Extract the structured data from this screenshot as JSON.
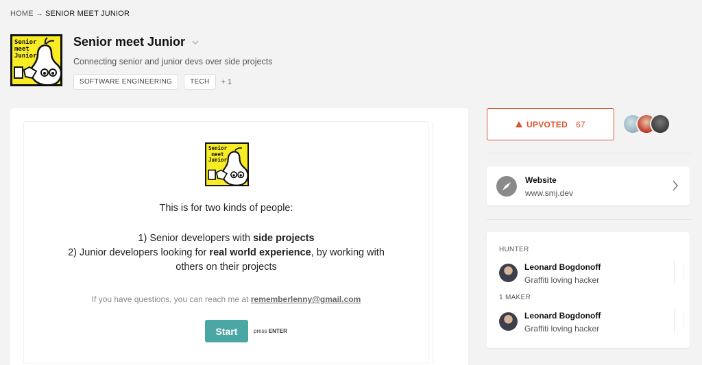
{
  "breadcrumb": {
    "home": "HOME",
    "separator": "→",
    "current": "SENIOR MEET JUNIOR"
  },
  "product": {
    "logo_text": "Senior\nmeet\nJunior",
    "title": "Senior meet Junior",
    "tagline": "Connecting senior and junior devs over side projects",
    "tags": [
      "SOFTWARE ENGINEERING",
      "TECH"
    ],
    "tags_more": "+ 1"
  },
  "embed": {
    "logo_text": "Senior\nmeet\nJunior",
    "intro": "This is for two kinds of people:",
    "point1_prefix": "1) Senior developers with ",
    "point1_bold": "side projects",
    "point2_prefix": "2) Junior developers looking for ",
    "point2_bold": "real world experience",
    "point2_suffix": ", by working with",
    "point2_line2": "others on their projects",
    "contact_prefix": "If you have questions, you can reach me at ",
    "contact_email": "rememberlenny@gmail.com",
    "start_label": "Start",
    "press_prefix": "press ",
    "press_key": "ENTER"
  },
  "upvote": {
    "label": "UPVOTED",
    "count": "67",
    "color": "#d9532c"
  },
  "website": {
    "label": "Website",
    "url": "www.smj.dev"
  },
  "people": {
    "hunter_label": "HUNTER",
    "hunter": {
      "name": "Leonard Bogdonoff",
      "desc": "Graffiti loving hacker"
    },
    "makers_label": "1 MAKER",
    "maker": {
      "name": "Leonard Bogdonoff",
      "desc": "Graffiti loving hacker"
    }
  },
  "colors": {
    "logo_yellow": "#f8ec25",
    "start_button": "#4aa7a3",
    "accent": "#d9532c"
  }
}
